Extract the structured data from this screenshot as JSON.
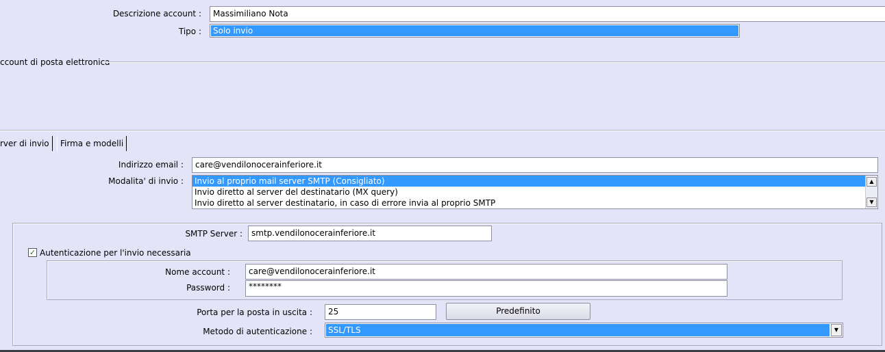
{
  "account": {
    "description_label": "Descrizione account :",
    "description_value": "Massimiliano Nota",
    "type_label": "Tipo :",
    "type_value": "Solo invio"
  },
  "section_email_account": "ccount di posta elettronica",
  "tabs": [
    {
      "label": "rver di invio",
      "active": true
    },
    {
      "label": "Firma e modelli",
      "active": false
    }
  ],
  "sending": {
    "email_label": "Indirizzo email :",
    "email_value": "care@vendilonocerainferiore.it",
    "mode_label": "Modalita' di invio :",
    "mode_options": [
      "Invio al proprio mail server SMTP (Consigliato)",
      "Invio diretto al server del destinatario (MX query)",
      "Invio diretto al server destinatario, in caso di errore invia al proprio SMTP"
    ],
    "mode_selected_index": 0
  },
  "smtp": {
    "server_label": "SMTP Server :",
    "server_value": "smtp.vendilonocerainferiore.it",
    "auth_checkbox_label": "Autenticazione per l'invio necessaria",
    "auth_checked": true,
    "account_label": "Nome account :",
    "account_value": "care@vendilonocerainferiore.it",
    "password_label": "Password :",
    "password_value": "********",
    "port_label": "Porta per la posta in uscita :",
    "port_value": "25",
    "default_button": "Predefinito",
    "auth_method_label": "Metodo di autenticazione :",
    "auth_method_value": "SSL/TLS"
  },
  "icons": {
    "scroll_up": "arrow-up-icon",
    "scroll_down": "arrow-down-icon",
    "dropdown": "chevron-down-icon",
    "check": "checkmark-icon"
  },
  "colors": {
    "background": "#e4e4f8",
    "selection": "#3399ff"
  }
}
